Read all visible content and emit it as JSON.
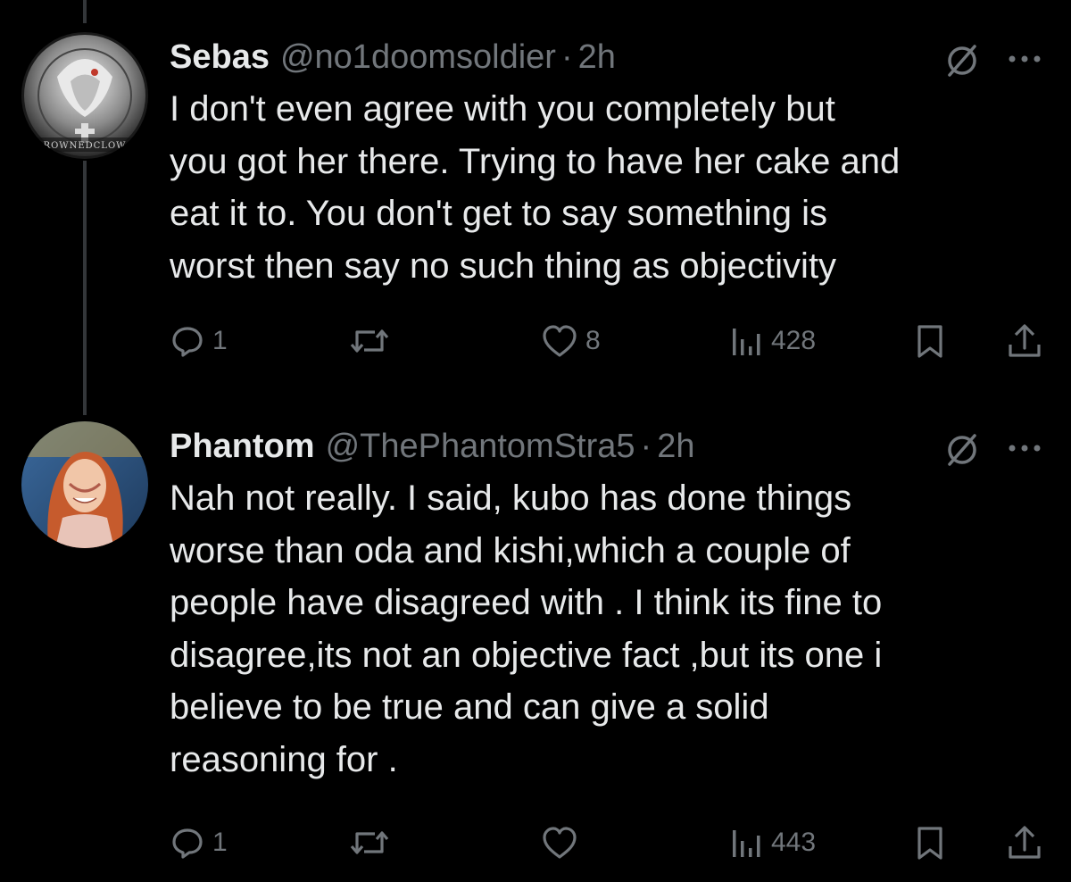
{
  "tweets": [
    {
      "name": "Sebas",
      "handle": "@no1doomsoldier",
      "separator": "·",
      "time": "2h",
      "text": "I don't even agree with you completely but\nyou got her there. Trying to have her cake and\neat it to. You don't get to say something is\nworst then say no such thing as objectivity",
      "avatar_caption": "ROWNEDCLOW",
      "replies": "1",
      "reposts": "",
      "likes": "8",
      "views": "428"
    },
    {
      "name": "Phantom",
      "handle": "@ThePhantomStra5",
      "separator": "·",
      "time": "2h",
      "text": "Nah not really. I said, kubo has done things\nworse than oda and kishi,which a couple of\npeople have disagreed with . I think its fine to\ndisagree,its not an objective fact ,but its one i\nbelieve to be true and can give a solid\nreasoning for .",
      "replies": "1",
      "reposts": "",
      "likes": "",
      "views": "443"
    }
  ],
  "icons": {
    "reply": "speech-bubble-icon",
    "repost": "repost-arrows-icon",
    "like": "heart-icon",
    "views": "bar-chart-icon",
    "bookmark": "bookmark-icon",
    "share": "share-upload-icon",
    "grok": "grok-slash-icon",
    "more": "more-dots-icon"
  },
  "colors": {
    "background": "#000000",
    "text": "#e7e9ea",
    "secondary": "#71767b",
    "thread_line": "#333639"
  }
}
